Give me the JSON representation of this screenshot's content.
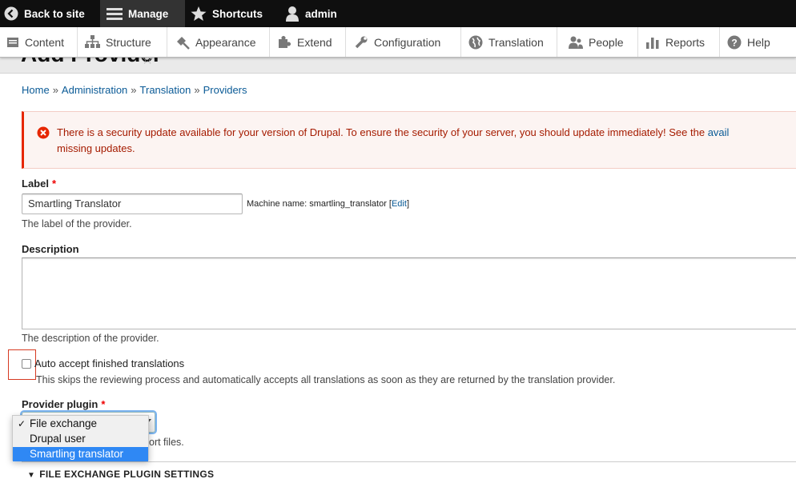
{
  "toolbar": {
    "back_label": "Back to site",
    "manage_label": "Manage",
    "shortcuts_label": "Shortcuts",
    "user_label": "admin"
  },
  "tray": {
    "items": [
      {
        "label": "Content",
        "icon": "content-icon"
      },
      {
        "label": "Structure",
        "icon": "structure-icon"
      },
      {
        "label": "Appearance",
        "icon": "appearance-icon"
      },
      {
        "label": "Extend",
        "icon": "extend-icon"
      },
      {
        "label": "Configuration",
        "icon": "configuration-icon"
      },
      {
        "label": "Translation",
        "icon": "globe-icon"
      },
      {
        "label": "People",
        "icon": "people-icon"
      },
      {
        "label": "Reports",
        "icon": "reports-icon"
      },
      {
        "label": "Help",
        "icon": "help-icon"
      }
    ]
  },
  "page": {
    "title": "Add Provider"
  },
  "breadcrumb": {
    "items": [
      "Home",
      "Administration",
      "Translation",
      "Providers"
    ],
    "separator": "»"
  },
  "error": {
    "text": "There is a security update available for your version of Drupal. To ensure the security of your server, you should update immediately! See the ",
    "link": "avail",
    "line2": "missing updates.",
    "color": "#e62600"
  },
  "form": {
    "label_title": "Label",
    "required_mark": "*",
    "label_value": "Smartling Translator",
    "machine_name_prefix": "Machine name: smartling_translator [",
    "machine_name_link": "Edit",
    "machine_name_suffix": "]",
    "label_description": "The label of the provider.",
    "description_title": "Description",
    "description_value": "",
    "description_help": "The description of the provider.",
    "auto_accept_label": "Auto accept finished translations",
    "auto_accept_checked": false,
    "auto_accept_help": "This skips the reviewing process and automatically accepts all translations as soon as they are returned by the translation provider.",
    "plugin_title": "Provider plugin",
    "plugin_options": [
      "File exchange",
      "Drupal user",
      "Smartling translator"
    ],
    "plugin_selected": "File exchange",
    "plugin_highlighted": "Smartling translator",
    "plugin_help_partial": "ort files.",
    "details_summary": "FILE EXCHANGE PLUGIN SETTINGS"
  },
  "colors": {
    "accent": "#2f88f4",
    "link": "#0a5a96",
    "error_text": "#a51b00"
  }
}
